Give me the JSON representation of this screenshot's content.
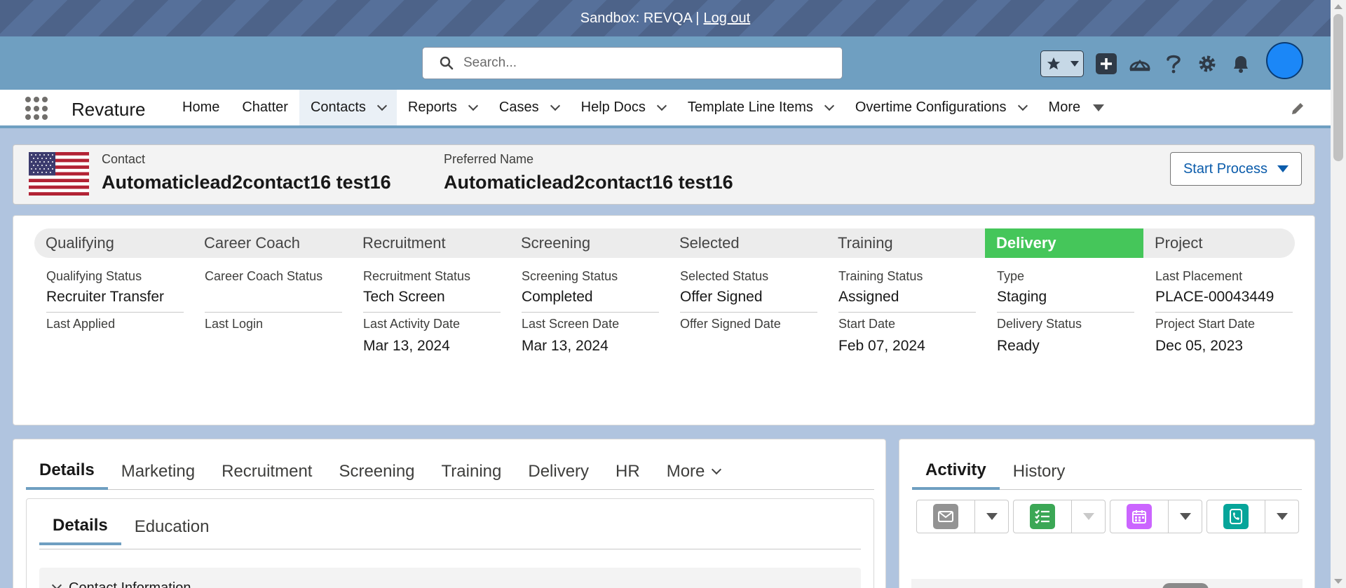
{
  "sandbox": {
    "text": "Sandbox: REVQA |",
    "logout": "Log out"
  },
  "search": {
    "placeholder": "Search..."
  },
  "header_icons": [
    "star-icon",
    "chevron-down-icon",
    "plus-icon",
    "trailhead-icon",
    "help-icon",
    "gear-icon",
    "bell-icon",
    "avatar"
  ],
  "app": {
    "name": "Revature"
  },
  "nav": {
    "items": [
      {
        "label": "Home"
      },
      {
        "label": "Chatter"
      },
      {
        "label": "Contacts"
      },
      {
        "label": "Reports"
      },
      {
        "label": "Cases"
      },
      {
        "label": "Help Docs"
      },
      {
        "label": "Template Line Items"
      },
      {
        "label": "Overtime Configurations"
      },
      {
        "label": "More"
      }
    ]
  },
  "highlights": {
    "record_type_label": "Contact",
    "record_name": "Automaticlead2contact16 test16",
    "preferred_label": "Preferred Name",
    "preferred_value": "Automaticlead2contact16 test16",
    "start_process": "Start Process"
  },
  "path": {
    "current_stage": "Delivery",
    "stages": [
      {
        "name": "Qualifying",
        "f1_label": "Qualifying Status",
        "f1_value": "Recruiter Transfer",
        "f2_label": "Last Applied",
        "f2_value": ""
      },
      {
        "name": "Career Coach",
        "f1_label": "Career Coach Status",
        "f1_value": "",
        "f2_label": "Last Login",
        "f2_value": ""
      },
      {
        "name": "Recruitment",
        "f1_label": "Recruitment Status",
        "f1_value": "Tech Screen",
        "f2_label": "Last Activity Date",
        "f2_value": "Mar 13, 2024"
      },
      {
        "name": "Screening",
        "f1_label": "Screening Status",
        "f1_value": "Completed",
        "f2_label": "Last Screen Date",
        "f2_value": "Mar 13, 2024"
      },
      {
        "name": "Selected",
        "f1_label": "Selected Status",
        "f1_value": "Offer Signed",
        "f2_label": "Offer Signed Date",
        "f2_value": ""
      },
      {
        "name": "Training",
        "f1_label": "Training Status",
        "f1_value": "Assigned",
        "f2_label": "Start Date",
        "f2_value": "Feb 07, 2024"
      },
      {
        "name": "Delivery",
        "f1_label": "Type",
        "f1_value": "Staging",
        "f2_label": "Delivery Status",
        "f2_value": "Ready"
      },
      {
        "name": "Project",
        "f1_label": "Last Placement",
        "f1_value": "PLACE-00043449",
        "f2_label": "Project Start Date",
        "f2_value": "Dec 05, 2023"
      }
    ]
  },
  "record_tabs": {
    "tabs": [
      "Details",
      "Marketing",
      "Recruitment",
      "Screening",
      "Training",
      "Delivery",
      "HR",
      "More"
    ],
    "active": "Details"
  },
  "details_subtabs": {
    "tabs": [
      "Details",
      "Education"
    ],
    "active": "Details"
  },
  "section": {
    "title": "Contact Information"
  },
  "activity": {
    "tabs": [
      "Activity",
      "History"
    ],
    "active": "Activity"
  },
  "colors": {
    "path_current": "#45c65a",
    "header_bg": "#6f9fc1",
    "brand_blue": "#0b5cab"
  }
}
